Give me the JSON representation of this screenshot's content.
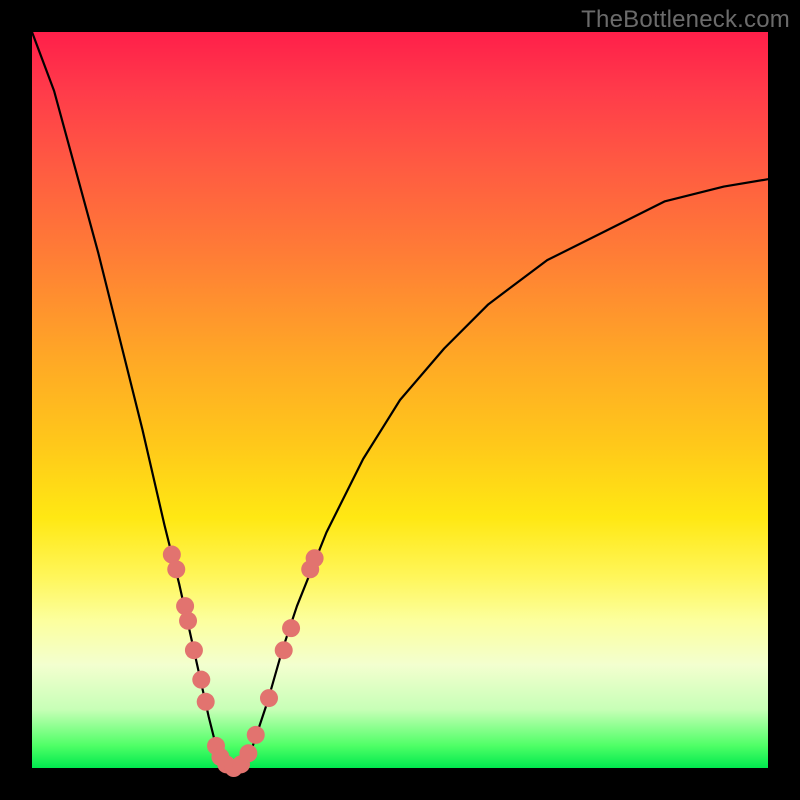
{
  "watermark": "TheBottleneck.com",
  "colors": {
    "frame": "#000000",
    "curve": "#000000",
    "dot_fill": "#e2736f",
    "gradient_stops": [
      {
        "pos": 0,
        "hex": "#ff1f4a"
      },
      {
        "pos": 8,
        "hex": "#ff3b4a"
      },
      {
        "pos": 18,
        "hex": "#ff5a42"
      },
      {
        "pos": 30,
        "hex": "#ff7c36"
      },
      {
        "pos": 44,
        "hex": "#ffa726"
      },
      {
        "pos": 56,
        "hex": "#ffc81a"
      },
      {
        "pos": 66,
        "hex": "#ffe813"
      },
      {
        "pos": 74,
        "hex": "#fff65a"
      },
      {
        "pos": 80,
        "hex": "#fcff9e"
      },
      {
        "pos": 86,
        "hex": "#f3ffcf"
      },
      {
        "pos": 92,
        "hex": "#c8ffb7"
      },
      {
        "pos": 97,
        "hex": "#4eff66"
      },
      {
        "pos": 100,
        "hex": "#00e84e"
      }
    ]
  },
  "chart_data": {
    "type": "line",
    "title": "",
    "xlabel": "",
    "ylabel": "",
    "x_range": [
      0,
      100
    ],
    "y_range": [
      0,
      100
    ],
    "note": "V-shaped bottleneck curve. y≈100 near x=0, dips to y≈0 at x≈27, rises toward y≈80 at x=100. Axes are implicit (no ticks); values estimated from plot area proportions.",
    "series": [
      {
        "name": "bottleneck-curve",
        "points": [
          {
            "x": 0,
            "y": 100
          },
          {
            "x": 3,
            "y": 92
          },
          {
            "x": 6,
            "y": 81
          },
          {
            "x": 9,
            "y": 70
          },
          {
            "x": 12,
            "y": 58
          },
          {
            "x": 15,
            "y": 46
          },
          {
            "x": 18,
            "y": 33
          },
          {
            "x": 20,
            "y": 25
          },
          {
            "x": 22,
            "y": 16
          },
          {
            "x": 24,
            "y": 7
          },
          {
            "x": 25,
            "y": 3
          },
          {
            "x": 26,
            "y": 1
          },
          {
            "x": 27,
            "y": 0
          },
          {
            "x": 28,
            "y": 0
          },
          {
            "x": 29,
            "y": 1
          },
          {
            "x": 30,
            "y": 3
          },
          {
            "x": 32,
            "y": 9
          },
          {
            "x": 34,
            "y": 16
          },
          {
            "x": 36,
            "y": 22
          },
          {
            "x": 40,
            "y": 32
          },
          {
            "x": 45,
            "y": 42
          },
          {
            "x": 50,
            "y": 50
          },
          {
            "x": 56,
            "y": 57
          },
          {
            "x": 62,
            "y": 63
          },
          {
            "x": 70,
            "y": 69
          },
          {
            "x": 78,
            "y": 73
          },
          {
            "x": 86,
            "y": 77
          },
          {
            "x": 94,
            "y": 79
          },
          {
            "x": 100,
            "y": 80
          }
        ]
      },
      {
        "name": "marker-dots",
        "style": "scatter",
        "points": [
          {
            "x": 19.0,
            "y": 29
          },
          {
            "x": 19.6,
            "y": 27
          },
          {
            "x": 20.8,
            "y": 22
          },
          {
            "x": 21.2,
            "y": 20
          },
          {
            "x": 22.0,
            "y": 16
          },
          {
            "x": 23.0,
            "y": 12
          },
          {
            "x": 23.6,
            "y": 9
          },
          {
            "x": 25.0,
            "y": 3
          },
          {
            "x": 25.6,
            "y": 1.5
          },
          {
            "x": 26.4,
            "y": 0.5
          },
          {
            "x": 27.4,
            "y": 0
          },
          {
            "x": 28.4,
            "y": 0.5
          },
          {
            "x": 29.4,
            "y": 2
          },
          {
            "x": 30.4,
            "y": 4.5
          },
          {
            "x": 32.2,
            "y": 9.5
          },
          {
            "x": 34.2,
            "y": 16
          },
          {
            "x": 35.2,
            "y": 19
          },
          {
            "x": 37.8,
            "y": 27
          },
          {
            "x": 38.4,
            "y": 28.5
          }
        ]
      }
    ]
  }
}
